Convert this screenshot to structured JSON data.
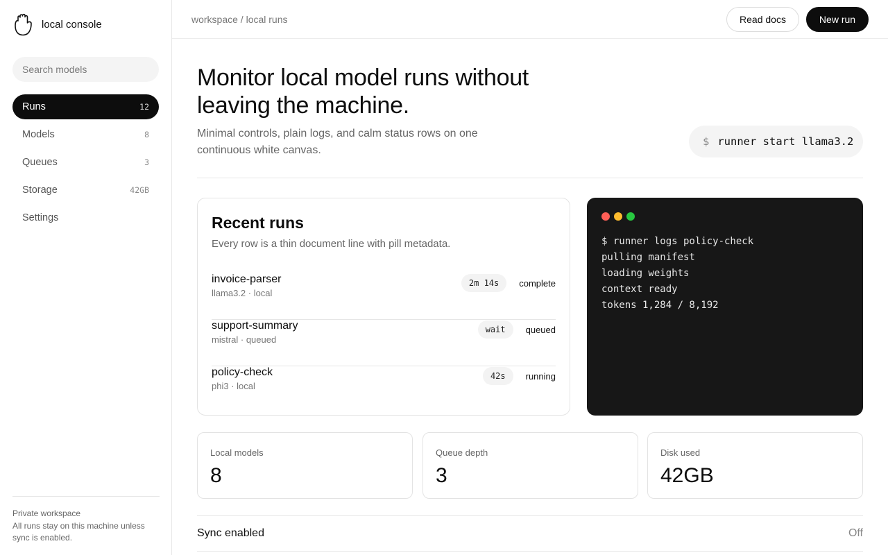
{
  "sidebar": {
    "brand_name": "local console",
    "search_placeholder": "Search models",
    "items": [
      {
        "label": "Runs",
        "count": "12"
      },
      {
        "label": "Models",
        "count": "8"
      },
      {
        "label": "Queues",
        "count": "3"
      },
      {
        "label": "Storage",
        "count": "42GB"
      },
      {
        "label": "Settings",
        "count": ""
      }
    ],
    "footer_title": "Private workspace",
    "footer_text": "All runs stay on this machine unless sync is enabled."
  },
  "header": {
    "breadcrumb": "workspace / local runs",
    "read_docs": "Read docs",
    "new_run": "New run"
  },
  "hero": {
    "title": "Monitor local model runs without leaving the machine.",
    "subtitle": "Minimal controls, plain logs, and calm status rows on one continuous white canvas.",
    "command_prompt": "$",
    "command": "runner start llama3.2"
  },
  "recent_runs": {
    "title": "Recent runs",
    "subtitle": "Every row is a thin document line with pill metadata.",
    "rows": [
      {
        "name": "invoice-parser",
        "meta": "llama3.2 · local",
        "pill": "2m 14s",
        "status": "complete"
      },
      {
        "name": "support-summary",
        "meta": "mistral · queued",
        "pill": "wait",
        "status": "queued"
      },
      {
        "name": "policy-check",
        "meta": "phi3 · local",
        "pill": "42s",
        "status": "running"
      }
    ]
  },
  "terminal": {
    "lines": [
      "$ runner logs policy-check",
      "pulling manifest",
      "loading weights",
      "context ready",
      "tokens 1,284 / 8,192"
    ],
    "dot_colors": [
      "#ff5f57",
      "#febc2e",
      "#28c840"
    ]
  },
  "stats": [
    {
      "label": "Local models",
      "value": "8"
    },
    {
      "label": "Queue depth",
      "value": "3"
    },
    {
      "label": "Disk used",
      "value": "42GB"
    }
  ],
  "sync": {
    "label": "Sync enabled",
    "value": "Off"
  }
}
